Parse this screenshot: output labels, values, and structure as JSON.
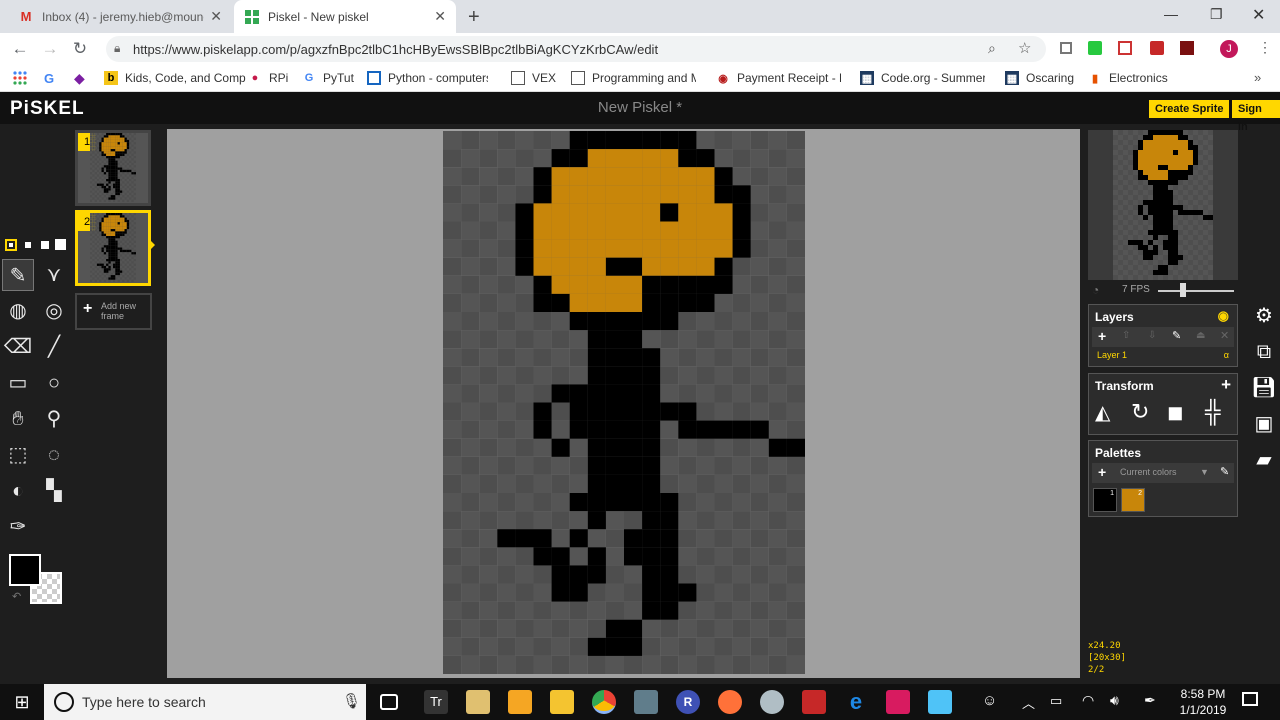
{
  "browser": {
    "tabs": [
      {
        "label": "Inbox (4) - jeremy.hieb@mounds",
        "active": false,
        "favicon": "gmail-icon"
      },
      {
        "label": "Piskel - New piskel",
        "active": true,
        "favicon": "piskel-icon"
      }
    ],
    "url": "https://www.piskelapp.com/p/agxzfnBpc2tlbC1hcHByEwsSBlBpc2tlbBiAgKCYzKrbCAw/edit",
    "bookmarks": [
      "Kids, Code, and Comp",
      "RPi",
      "PyTut",
      "Python - computersfo",
      "VEX",
      "Programming and M",
      "Payment Receipt - Re",
      "Code.org - Summer I",
      "Oscaring",
      "Electronics"
    ],
    "profile_initial": "J"
  },
  "piskel": {
    "logo": "PiSKEL",
    "title": "New Piskel *",
    "create_sprite": "Create Sprite",
    "sign_in": "Sign in",
    "frames": [
      {
        "number": "1"
      },
      {
        "number": "2"
      }
    ],
    "add_frame": "Add new frame",
    "fps_label": "7 FPS",
    "fps_value": 7,
    "layers": {
      "title": "Layers",
      "layer_name": "Layer 1",
      "alpha_label": "α"
    },
    "transform": {
      "title": "Transform"
    },
    "palettes": {
      "title": "Palettes",
      "current": "Current colors",
      "swatch_labels": [
        "1",
        "2"
      ]
    },
    "coords": {
      "position": "x24.20",
      "size": "[20x30]",
      "frame": "2/2"
    },
    "colors": {
      "primary": "#000000",
      "accent": "#ffd700",
      "orange": "#c8860a"
    }
  },
  "canvas_pixels": {
    "width": 20,
    "height": 30,
    "orange": "#c8860a",
    "black": "#000000",
    "rows": [
      "0000000KKKKKKK000000",
      "000000KKOOOOOKK00000",
      "00000KOOOOOOOOOK0000",
      "00000KOOOOOOOOOKK000",
      "0000KOOOOOOOKOOOK000",
      "0000KOOOOOOOOOOOK000",
      "0000KOOOOOOOOOOOK000",
      "0000KOOOOKKOOOOK0000",
      "00000KOOOOOKKKKK0000",
      "00000KKOOOOKKKK00000",
      "0000000KKKKKK0000000",
      "00000000KKK000000000",
      "00000000KKKK00000000",
      "00000000KKKK00000000",
      "000000KKKKKK00000000",
      "00000K0KKKKKKK000000",
      "00000K0KKKKK0KKKKK00",
      "000000K0KKKK000000KK",
      "00000000KKKK00000000",
      "00000000KKKK00000000",
      "0000000KKKKKK0000000",
      "00000000K00KK0000000",
      "000KKK0K00KKK0000000",
      "00000KK0K0KKK0000000",
      "000000KKK00KK0000000",
      "000000KK000KKK000000",
      "00000000000KK0000000",
      "000000000KK000000000",
      "00000000KKK000000000",
      "00000000000000000000"
    ]
  },
  "taskbar": {
    "search_placeholder": "Type here to search",
    "time": "8:58 PM",
    "date": "1/1/2019"
  }
}
